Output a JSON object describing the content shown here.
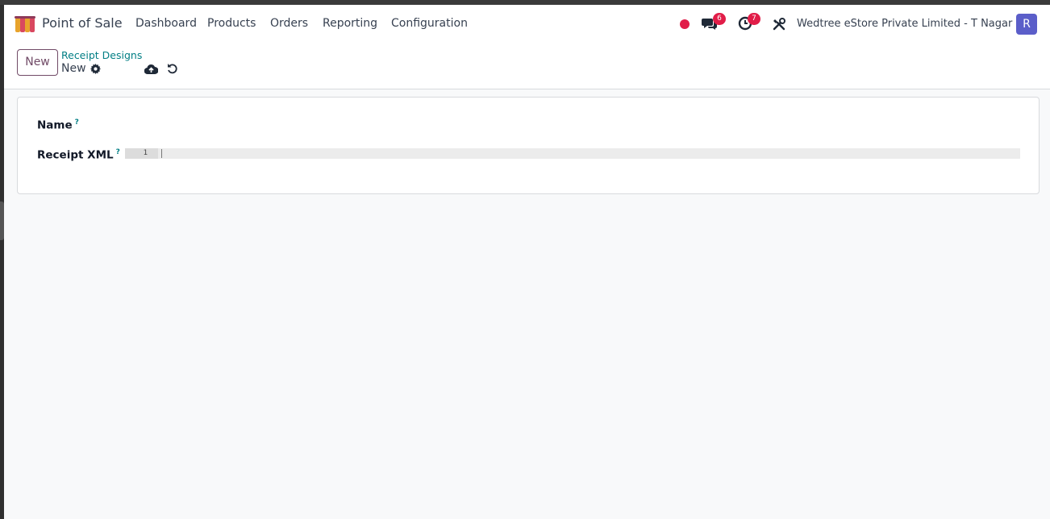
{
  "navbar": {
    "app_title": "Point of Sale",
    "menu": [
      "Dashboard",
      "Products",
      "Orders",
      "Reporting",
      "Configuration"
    ],
    "status_color": "#e11d48",
    "messages_badge": "6",
    "activities_badge": "7",
    "company": "Wedtree eStore Private Limited - T Nagar",
    "avatar_letter": "R"
  },
  "control_panel": {
    "new_button": "New",
    "breadcrumb_parent": "Receipt Designs",
    "breadcrumb_current": "New"
  },
  "form": {
    "name_label": "Name",
    "name_help": "?",
    "name_value": "",
    "xml_label": "Receipt XML",
    "xml_help": "?",
    "xml_line_number": "1"
  },
  "colors": {
    "accent": "#714b67",
    "link": "#017e84",
    "badge": "#e11d48",
    "avatar": "#5b5ec9"
  }
}
